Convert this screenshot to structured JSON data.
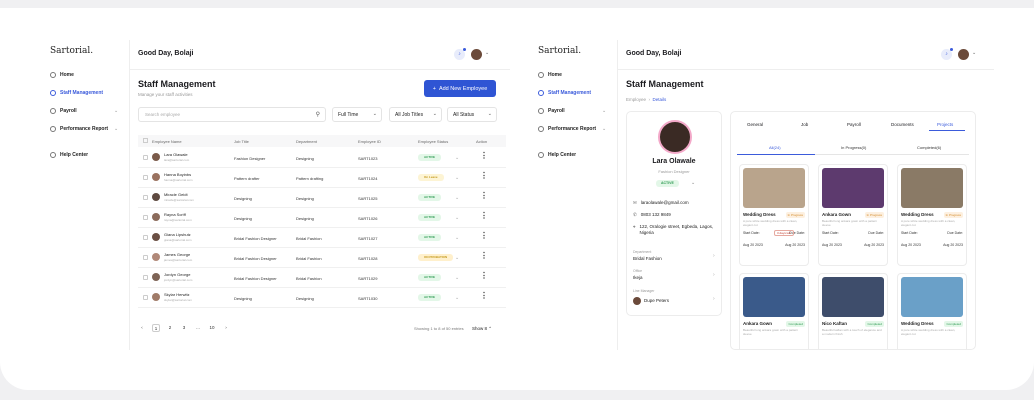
{
  "left": {
    "logo": "Sartorial.",
    "nav": [
      {
        "label": "Home"
      },
      {
        "label": "Staff Management"
      },
      {
        "label": "Payroll"
      },
      {
        "label": "Performance Report"
      },
      {
        "label": "Help Center"
      }
    ],
    "greeting": "Good Day, Bolaji",
    "title": "Staff Management",
    "subtitle": "Manage your staff activities",
    "add_button": "Add New Employee",
    "search_placeholder": "Search employee",
    "filters": [
      "Full Time",
      "All Job Titles",
      "All Status"
    ],
    "columns": [
      "Employee Name",
      "Job Title",
      "Department",
      "Employee ID",
      "Employee Status",
      "Action"
    ],
    "rows": [
      {
        "name": "Lara Olawale",
        "email": "lara@sartorial.com",
        "job": "Fashion Designer",
        "dept": "Designing",
        "id": "SART1023",
        "status": "ACTIVE",
        "kind": "active"
      },
      {
        "name": "Hanna Boyinbs",
        "email": "hanna@sartorial.com",
        "job": "Pattern drafter",
        "dept": "Pattern drafting",
        "id": "SART1024",
        "status": "On Leave",
        "kind": "leave"
      },
      {
        "name": "Miracle Geidt",
        "email": "miracle@sartorial.com",
        "job": "Designing",
        "dept": "Designing",
        "id": "SART1025",
        "status": "ACTIVE",
        "kind": "active"
      },
      {
        "name": "Rayna Scriff",
        "email": "rayna@sartorial.com",
        "job": "Designing",
        "dept": "Designing",
        "id": "SART1026",
        "status": "ACTIVE",
        "kind": "active"
      },
      {
        "name": "Giana Lipshutz",
        "email": "giana@sartorial.com",
        "job": "Bridal Fashion Designer",
        "dept": "Bridal Fashion",
        "id": "SART1027",
        "status": "ACTIVE",
        "kind": "active"
      },
      {
        "name": "James George",
        "email": "james@sartorial.com",
        "job": "Bridal Fashion Designer",
        "dept": "Bridal Fashion",
        "id": "SART1028",
        "status": "ON PROBATION",
        "kind": "prob"
      },
      {
        "name": "Jordyn George",
        "email": "jordyn@sartorial.com",
        "job": "Bridal Fashion Designer",
        "dept": "Bridal Fashion",
        "id": "SART1029",
        "status": "ACTIVE",
        "kind": "active"
      },
      {
        "name": "Skylar Herwitz",
        "email": "skylar@sartorial.com",
        "job": "Designing",
        "dept": "Designing",
        "id": "SART1030",
        "status": "ACTIVE",
        "kind": "active"
      }
    ],
    "pager": {
      "prev": "‹",
      "p1": "1",
      "p2": "2",
      "p3": "3",
      "ellipsis": "...",
      "p10": "10",
      "next": "›"
    },
    "showing": "Showing 1 to 8 of 50 entries",
    "show_select": "Show 8"
  },
  "right": {
    "logo": "Sartorial.",
    "nav": [
      {
        "label": "Home"
      },
      {
        "label": "Staff Management"
      },
      {
        "label": "Payroll"
      },
      {
        "label": "Performance Report"
      },
      {
        "label": "Help Center"
      }
    ],
    "greeting": "Good Day, Bolaji",
    "title": "Staff Management",
    "breadcrumb_root": "Employee",
    "breadcrumb_current": "Details",
    "profile": {
      "name": "Lara Olawale",
      "role": "Fashion Designer",
      "status": "ACTIVE",
      "email": "laraolawale@gmail.com",
      "phone": "0803 132 9849",
      "address": "122, Oralogie street, Egbeda, Lagos, Nigeria",
      "dept_label": "Department",
      "dept": "Bridal Fashion",
      "office_label": "Office",
      "office": "Ikeja",
      "manager_label": "Line Manager",
      "manager": "Dupe Peters"
    },
    "tabs": [
      "General",
      "Job",
      "Payroll",
      "Documents",
      "Projects"
    ],
    "subtabs": [
      "All(24)",
      "In Progress(0)",
      "Completed(6)"
    ],
    "projects": [
      {
        "title": "Wedding Dress",
        "status": "In Progress",
        "kind": "prog",
        "desc": "A pure white wedding dress with a clean, elegant cut",
        "start_label": "Start Date:",
        "due_label": "Due Date:",
        "start": "Aug 20 2023",
        "due": "Aug 20 2023",
        "overdue": "3 days left",
        "color": "#b9a48c"
      },
      {
        "title": "Ankara Gown",
        "status": "In Progress",
        "kind": "prog",
        "desc": "Beautiful long ankara gown with a pattern sleeve",
        "start_label": "Start Date:",
        "due_label": "Due Date:",
        "start": "Aug 20 2023",
        "due": "Aug 20 2023",
        "overdue": "",
        "color": "#5d3a6e"
      },
      {
        "title": "Wedding Dress",
        "status": "In Progress",
        "kind": "prog",
        "desc": "A pure white wedding dress with a clean, elegant cut",
        "start_label": "Start Date:",
        "due_label": "Due Date:",
        "start": "Aug 20 2023",
        "due": "Aug 20 2023",
        "overdue": "",
        "color": "#8a7a66"
      },
      {
        "title": "Ankara Gown",
        "status": "Completed",
        "kind": "done",
        "desc": "Beautiful long ankara gown with a pattern sleeve",
        "color": "#3a5a8a"
      },
      {
        "title": "Nico Kaftan",
        "status": "Completed",
        "kind": "done",
        "desc": "Beautiful kaftan with a touch of elegance and a modern finish",
        "color": "#3e4d6b"
      },
      {
        "title": "Wedding Dress",
        "status": "Completed",
        "kind": "done",
        "desc": "A pure white wedding dress with a clean, elegant cut",
        "color": "#6aa0c8"
      }
    ]
  }
}
